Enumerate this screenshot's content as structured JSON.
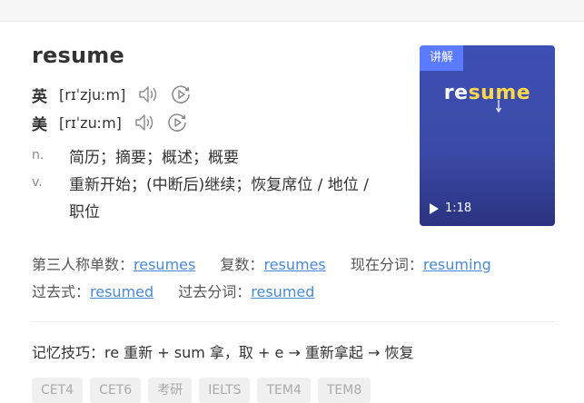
{
  "word": "resume",
  "pronunciations": [
    {
      "lang": "英",
      "ipa": "[rɪˈzjuːm]"
    },
    {
      "lang": "美",
      "ipa": "[rɪˈzuːm]"
    }
  ],
  "definitions": [
    {
      "pos": "n.",
      "text": "简历；摘要；概述；概要"
    },
    {
      "pos": "v.",
      "text": "重新开始；(中断后)继续；恢复席位 / 地位 / 职位"
    }
  ],
  "word_forms": {
    "third_person_label": "第三人称单数：",
    "third_person": "resumes",
    "plural_label": "复数：",
    "plural": "resumes",
    "present_participle_label": "现在分词：",
    "present_participle": "resuming",
    "past_tense_label": "过去式：",
    "past_tense": "resumed",
    "past_participle_label": "过去分词：",
    "past_participle": "resumed"
  },
  "memory_tip": "记忆技巧：re 重新 + sum 拿，取 + e → 重新拿起 → 恢复",
  "tags": [
    "CET4",
    "CET6",
    "考研",
    "IELTS",
    "TEM4",
    "TEM8"
  ],
  "video": {
    "badge": "讲解",
    "title_prefix": "re",
    "title_highlight": "sume",
    "duration": "1:18"
  },
  "icons": {
    "speaker": "speaker-icon",
    "replay": "play-circle-icon",
    "video_play": "play-icon"
  },
  "colors": {
    "link": "#4a8ad4",
    "badge": "#5b7bff",
    "highlight": "#ffd84a"
  }
}
